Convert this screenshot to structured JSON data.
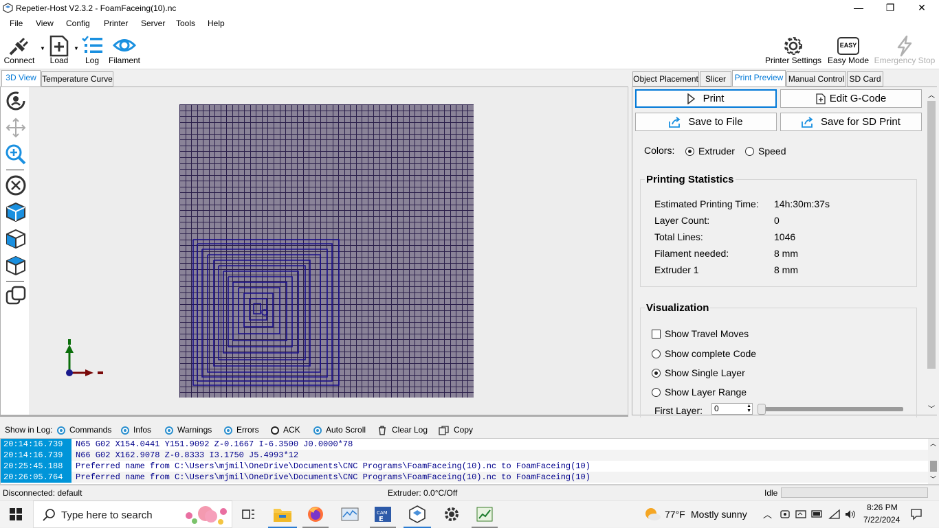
{
  "window": {
    "title": "Repetier-Host V2.3.2 - FoamFaceing(10).nc",
    "min_glyph": "—",
    "max_glyph": "❐",
    "close_glyph": "✕"
  },
  "menu": [
    "File",
    "View",
    "Config",
    "Printer",
    "Server",
    "Tools",
    "Help"
  ],
  "toolbar": {
    "connect": "Connect",
    "load": "Load",
    "log": "Log",
    "filament": "Filament",
    "printer_settings": "Printer Settings",
    "easy_mode": "Easy Mode",
    "easy_badge": "EASY",
    "emergency_stop": "Emergency Stop"
  },
  "left_tabs": [
    "3D View",
    "Temperature Curve"
  ],
  "viewport_icons": [
    "rotate-icon",
    "move-icon",
    "zoom-icon",
    "fit-icon",
    "iso-view-icon",
    "front-view-icon",
    "top-view-icon",
    "parallel-view-icon"
  ],
  "right_tabs": [
    "Object Placement",
    "Slicer",
    "Print Preview",
    "Manual Control",
    "SD Card"
  ],
  "preview": {
    "print": "Print",
    "edit_gcode": "Edit G-Code",
    "save_to_file": "Save to File",
    "save_for_sd": "Save for SD Print",
    "colors_label": "Colors:",
    "color_extruder": "Extruder",
    "color_speed": "Speed",
    "color_selected": "Extruder"
  },
  "stats": {
    "title": "Printing Statistics",
    "rows": [
      {
        "label": "Estimated Printing Time:",
        "value": "14h:30m:37s"
      },
      {
        "label": "Layer Count:",
        "value": "0"
      },
      {
        "label": "Total Lines:",
        "value": "1046"
      },
      {
        "label": "Filament needed:",
        "value": "8 mm"
      },
      {
        "label": "Extruder 1",
        "value": "8 mm"
      }
    ]
  },
  "visualization": {
    "title": "Visualization",
    "show_travel": "Show Travel Moves",
    "show_travel_checked": false,
    "show_complete": "Show complete Code",
    "show_single": "Show Single Layer",
    "show_range": "Show Layer Range",
    "selected": "Show Single Layer",
    "first_layer_label": "First Layer:",
    "first_layer_value": "0"
  },
  "log": {
    "show_label": "Show in Log:",
    "options": [
      {
        "label": "Commands",
        "on": true
      },
      {
        "label": "Infos",
        "on": true
      },
      {
        "label": "Warnings",
        "on": true
      },
      {
        "label": "Errors",
        "on": true
      },
      {
        "label": "ACK",
        "on": false
      },
      {
        "label": "Auto Scroll",
        "on": true
      }
    ],
    "clear": "Clear Log",
    "copy": "Copy",
    "entries": [
      {
        "time": "20:14:16.739",
        "msg": "N65 G02 X154.0441 Y151.9092 Z-0.1667 I-6.3500 J0.0000*78"
      },
      {
        "time": "20:14:16.739",
        "msg": "N66 G02 X162.9078 Z-0.8333 I3.1750 J5.4993*12"
      },
      {
        "time": "20:25:45.188",
        "msg": "Preferred name from C:\\Users\\mjmil\\OneDrive\\Documents\\CNC Programs\\FoamFaceing(10).nc to FoamFaceing(10)"
      },
      {
        "time": "20:26:05.764",
        "msg": "Preferred name from C:\\Users\\mjmil\\OneDrive\\Documents\\CNC Programs\\FoamFaceing(10).nc to FoamFaceing(10)"
      }
    ]
  },
  "status": {
    "connection": "Disconnected: default",
    "extruder": "Extruder: 0.0°C/Off",
    "state": "Idle"
  },
  "taskbar": {
    "search_placeholder": "Type here to search",
    "weather_temp": "77°F",
    "weather_desc": "Mostly sunny",
    "time": "8:26 PM",
    "date": "7/22/2024"
  },
  "colors": {
    "accent": "#0078d7",
    "grid_bg": "#8a8398",
    "grid_line": "#2a1e4a",
    "toolpath": "#1a0f8c",
    "log_ts": "#0095d9"
  }
}
